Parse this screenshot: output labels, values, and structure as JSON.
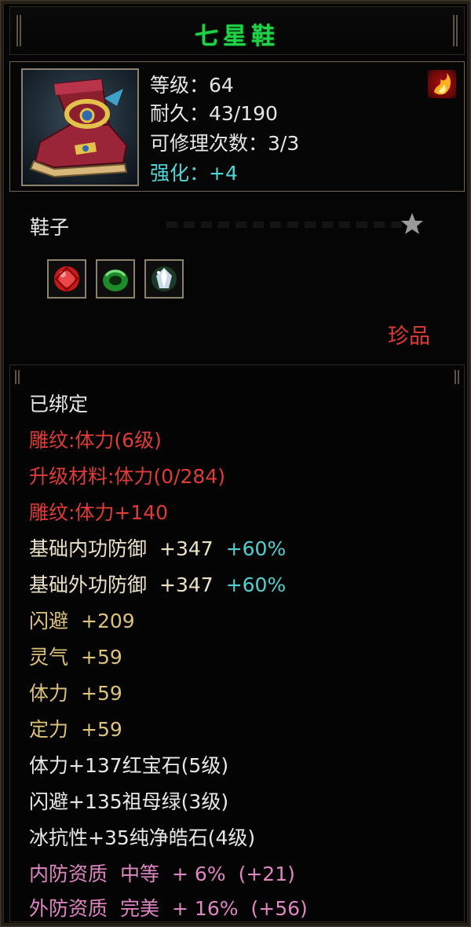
{
  "title": "七星鞋",
  "header": {
    "level_label": "等级：64",
    "durability_label": "耐久：43/190",
    "repair_label": "可修理次数：3/3",
    "enhance_label": "强化：+4"
  },
  "item_type": "鞋子",
  "gems": [
    "ruby-gem-icon",
    "emerald-gem-icon",
    "diamond-gem-icon"
  ],
  "rarity": "珍品",
  "details": {
    "bound": "已绑定",
    "engrave": "雕纹:体力(6级)",
    "upgrade_material": "升级材料:体力(0/284)",
    "engrave_bonus": "雕纹:体力+140",
    "inner_def": {
      "name": "基础内功防御",
      "value": "+347",
      "bonus": "+60%"
    },
    "outer_def": {
      "name": "基础外功防御",
      "value": "+347",
      "bonus": "+60%"
    },
    "stats": [
      {
        "name": "闪避",
        "value": "+209"
      },
      {
        "name": "灵气",
        "value": "+59"
      },
      {
        "name": "体力",
        "value": "+59"
      },
      {
        "name": "定力",
        "value": "+59"
      }
    ],
    "gem_bonus_1": "体力+137红宝石(5级)",
    "gem_bonus_2": "闪避+135祖母绿(3级)",
    "gem_bonus_3": "冰抗性+35纯净皓石(4级)",
    "inner_quality": {
      "name": "内防资质",
      "grade": "中等",
      "value": "+ 6%",
      "extra": "(+21)"
    },
    "outer_quality": {
      "name": "外防资质",
      "grade": "完美",
      "value": "+ 16%",
      "extra": "(+56)"
    }
  },
  "colors": {
    "title": "#20d248",
    "red": "#df3c38",
    "cyan": "#52d0d0",
    "gold": "#dcc27a",
    "pink": "#df86c2"
  }
}
